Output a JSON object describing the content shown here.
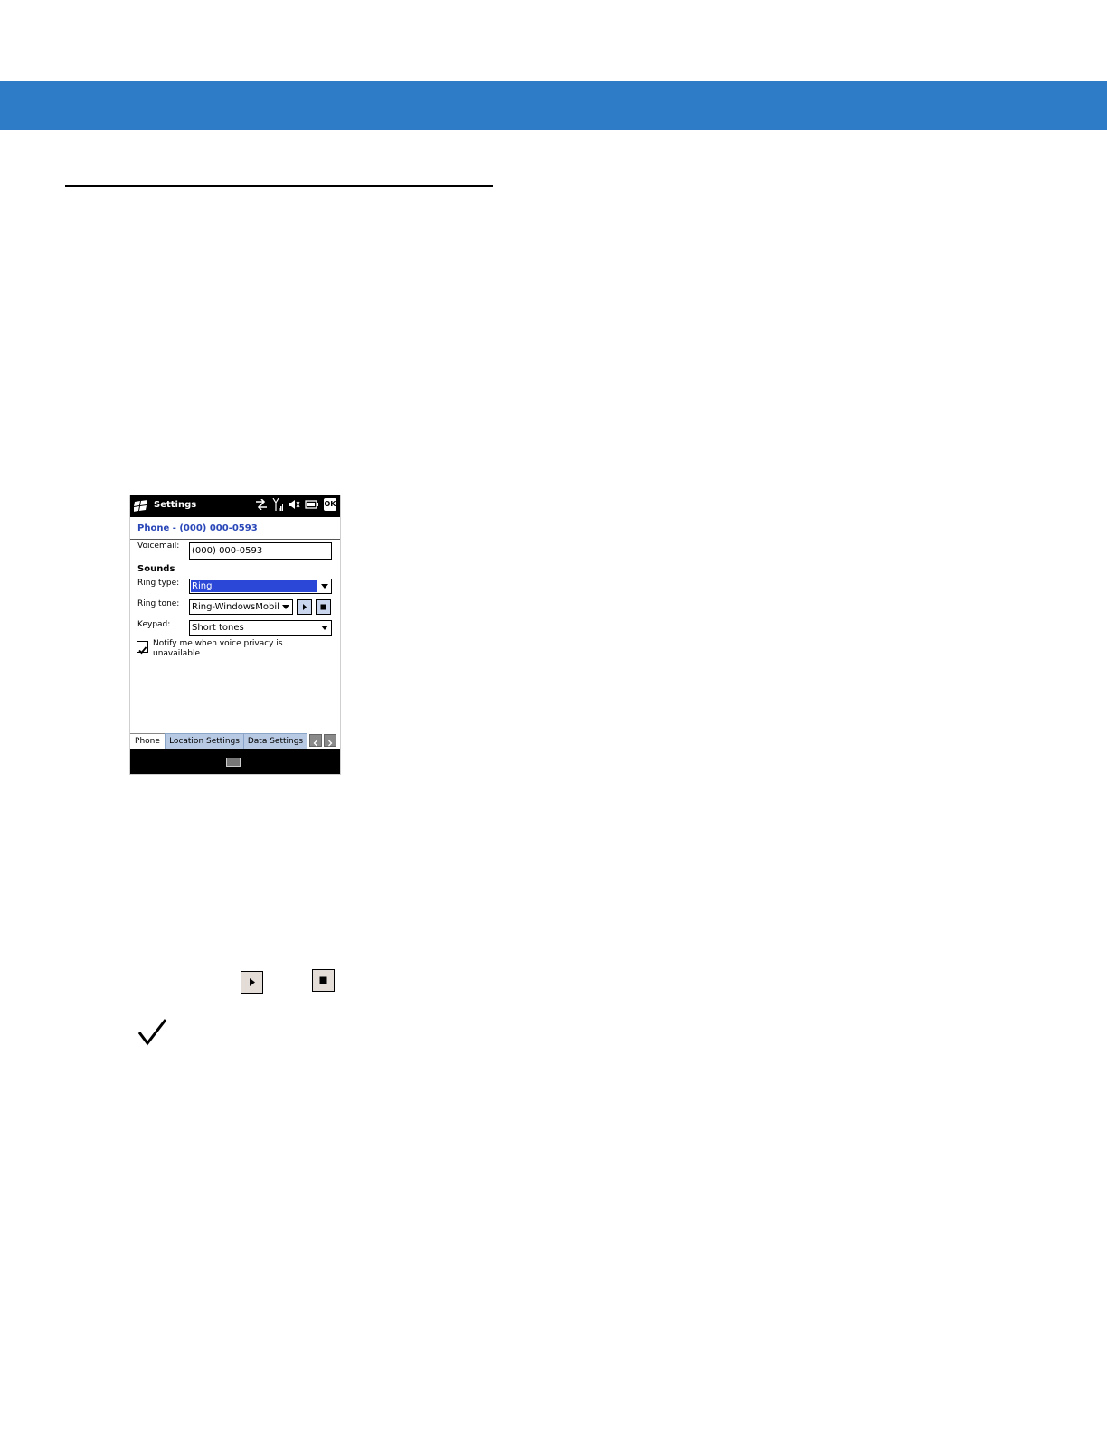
{
  "device": {
    "title": "Settings",
    "ok_label": "OK",
    "phone_header": "Phone - (000) 000-0593",
    "voicemail_label": "Voicemail:",
    "voicemail_value": "(000) 000-0593",
    "sounds_heading": "Sounds",
    "ring_type_label": "Ring type:",
    "ring_type_value": "Ring",
    "ring_tone_label": "Ring tone:",
    "ring_tone_value": "Ring-WindowsMobile",
    "keypad_label": "Keypad:",
    "keypad_value": "Short tones",
    "notify_checked": true,
    "notify_text": "Notify me when voice privacy is unavailable",
    "tabs": [
      "Phone",
      "Location Settings",
      "Data Settings"
    ],
    "active_tab": "Phone"
  },
  "colors": {
    "top_band": "#2e7bc8",
    "header_text": "#2a47b8",
    "selection": "#2a47d8",
    "tab_inactive": "#b7c9e3"
  }
}
